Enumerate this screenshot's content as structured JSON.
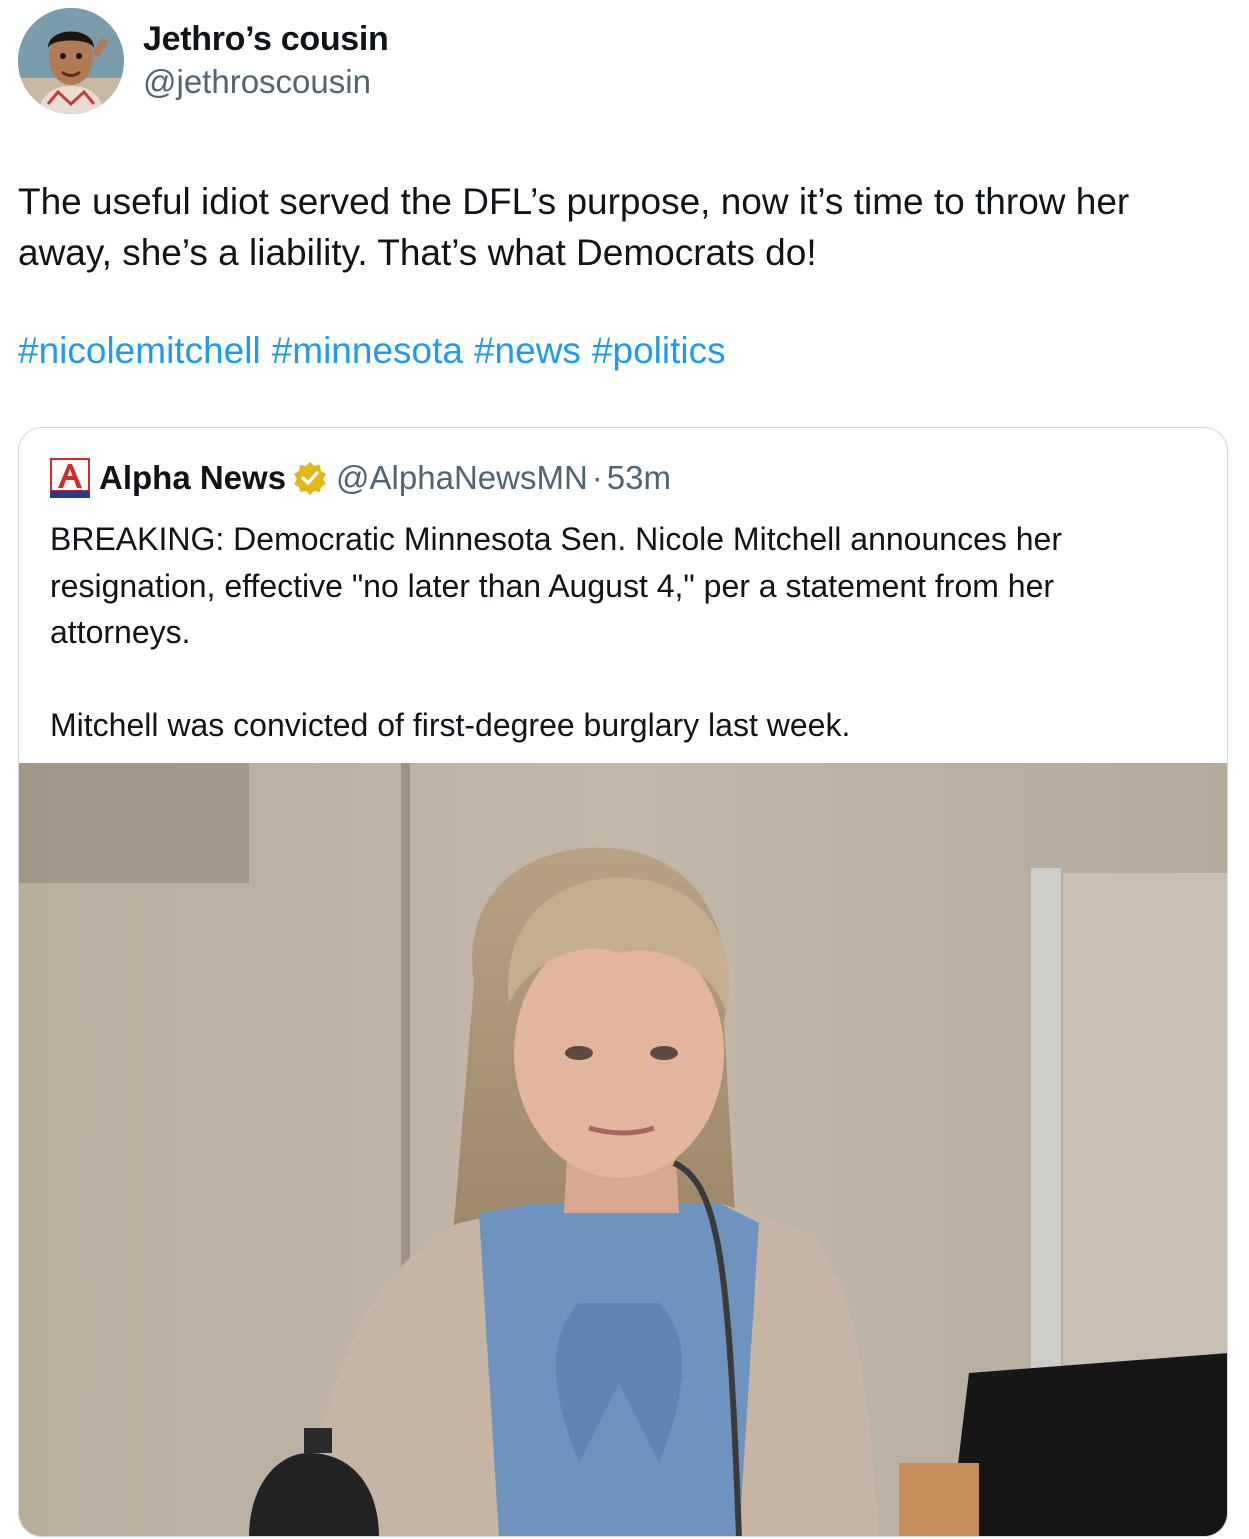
{
  "author": {
    "display_name": "Jethro’s cousin",
    "handle": "@jethroscousin",
    "avatar_icon": "profile-photo-man-pointing-at-temple"
  },
  "tweet": {
    "text": "The useful idiot served the DFL’s purpose, now it’s time to throw her away, she’s a liability. That’s what Democrats do!",
    "hashtags": [
      "#nicolemitchell",
      "#minnesota",
      "#news",
      "#politics"
    ],
    "hashtag_color": "#1d9bf0"
  },
  "quoted_tweet": {
    "logo_icon": "alpha-news-logo",
    "display_name": "Alpha News",
    "verified_icon": "gold-verified-badge-icon",
    "handle": "@AlphaNewsMN",
    "separator": "·",
    "time": "53m",
    "text": "BREAKING: Democratic Minnesota Sen. Nicole Mitchell announces her resignation, effective \"no later than August 4,\" per a statement from her attorneys.\n\nMitchell was convicted of first-degree burglary last week.",
    "media_icon": "courtroom-photo-woman-testifying"
  }
}
